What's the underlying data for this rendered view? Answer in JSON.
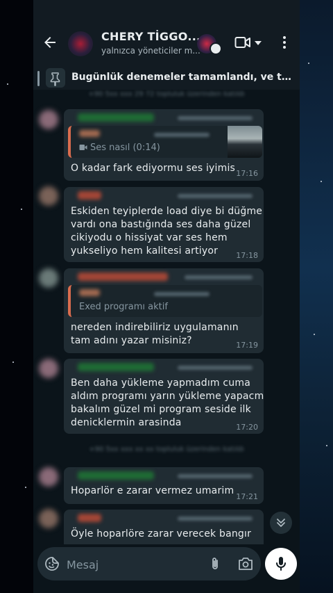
{
  "header": {
    "title": "CHERY TİGGO...",
    "subtitle": "yalnızca yöneticiler m..."
  },
  "pinned": {
    "text": "Bugünlük denemeler tamamlandı, ve tam başarılı..."
  },
  "messages": [
    {
      "quote_text": "Ses nasıl (0:14)",
      "text_lines": [
        "O kadar fark ediyormu ses iyimis"
      ],
      "time": "17:16"
    },
    {
      "text_lines": [
        "Eskiden teyiplerde load diye bi düğme",
        "vardı ona bastığında ses daha güzel",
        "cikiyodu o hissiyat var ses hem",
        "yukseliyo hem kalitesi artiyor"
      ],
      "time": "17:18"
    },
    {
      "quote_text": "Exed programı aktif",
      "text_lines": [
        "nereden indirebiliriz    uygulamanın",
        "tam adını yazar misiniz?"
      ],
      "time": "17:19"
    },
    {
      "text_lines": [
        "Ben daha yükleme yapmadım cuma",
        "aldım programı yarın yükleme yapacm",
        "bakalım güzel mi program seside ilk",
        "denicklermin arasinda"
      ],
      "time": "17:20"
    },
    {
      "text_lines": [
        "Hoparlör e zarar vermez umarim"
      ],
      "time": "17:21"
    },
    {
      "text_lines": [
        "Öyle hoparlöre zarar verecek bangır"
      ],
      "time": ""
    }
  ],
  "input": {
    "placeholder": "Mesaj"
  },
  "colors": {
    "background": "#0b141a",
    "bar": "#121b22",
    "bubble": "#202c33",
    "text": "#e9edef",
    "muted": "#8696a0",
    "sender_green": "#2ea043",
    "sender_red": "#c0503c",
    "quote_accent": "#d96c4e"
  },
  "icons": [
    "back-arrow-icon",
    "video-call-icon",
    "chevron-down-icon",
    "more-vert-icon",
    "pin-icon",
    "video-icon",
    "double-chevron-down-icon",
    "sticker-icon",
    "paperclip-icon",
    "camera-icon",
    "microphone-icon"
  ]
}
